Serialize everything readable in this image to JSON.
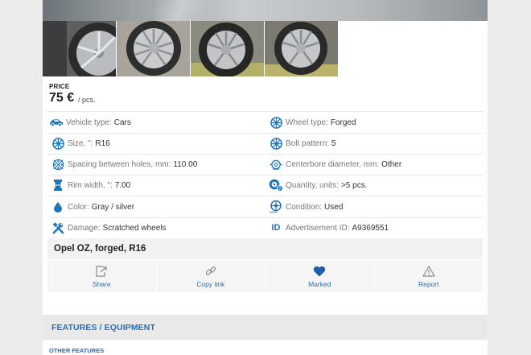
{
  "price": {
    "label": "PRICE",
    "amount": "75 €",
    "unit": "/ pcs."
  },
  "specs": [
    {
      "icon": "car-icon",
      "label": "Vehicle type:",
      "value": "Cars"
    },
    {
      "icon": "wheel-icon",
      "label": "Wheel type:",
      "value": "Forged"
    },
    {
      "icon": "wheel-icon",
      "label": "Size, \":",
      "value": "R16"
    },
    {
      "icon": "wheel-icon",
      "label": "Bolt pattern:",
      "value": "5"
    },
    {
      "icon": "spacing-icon",
      "label": "Spacing between holes, mm:",
      "value": "110.00"
    },
    {
      "icon": "centerbore-icon",
      "label": "Centerbore diameter, mm:",
      "value": "Other"
    },
    {
      "icon": "rim-width-icon",
      "label": "Rim width, \":",
      "value": "7.00"
    },
    {
      "icon": "quantity-icon",
      "label": "Quantity, units:",
      "value": ">5 pcs."
    },
    {
      "icon": "drop-icon",
      "label": "Color:",
      "value": "Gray / silver"
    },
    {
      "icon": "used-condition-icon",
      "label": "Condition:",
      "value": "Used"
    },
    {
      "icon": "tools-icon",
      "label": "Damage:",
      "value": "Scratched wheels"
    },
    {
      "icon": "id-icon",
      "label": "Advertisement ID:",
      "value": "A9369551"
    }
  ],
  "id_badge": "ID",
  "used_badge": "used",
  "listing_title": "Opel OZ, forged, R16",
  "actions": [
    {
      "icon": "share-icon",
      "label": "Share"
    },
    {
      "icon": "link-icon",
      "label": "Copy link"
    },
    {
      "icon": "heart-icon",
      "label": "Marked"
    },
    {
      "icon": "warning-icon",
      "label": "Report"
    }
  ],
  "features": {
    "title": "FEATURES / EQUIPMENT",
    "subtitle": "OTHER FEATURES"
  },
  "colors": {
    "accent": "#2a6db4",
    "icon": "#1f74b8"
  }
}
